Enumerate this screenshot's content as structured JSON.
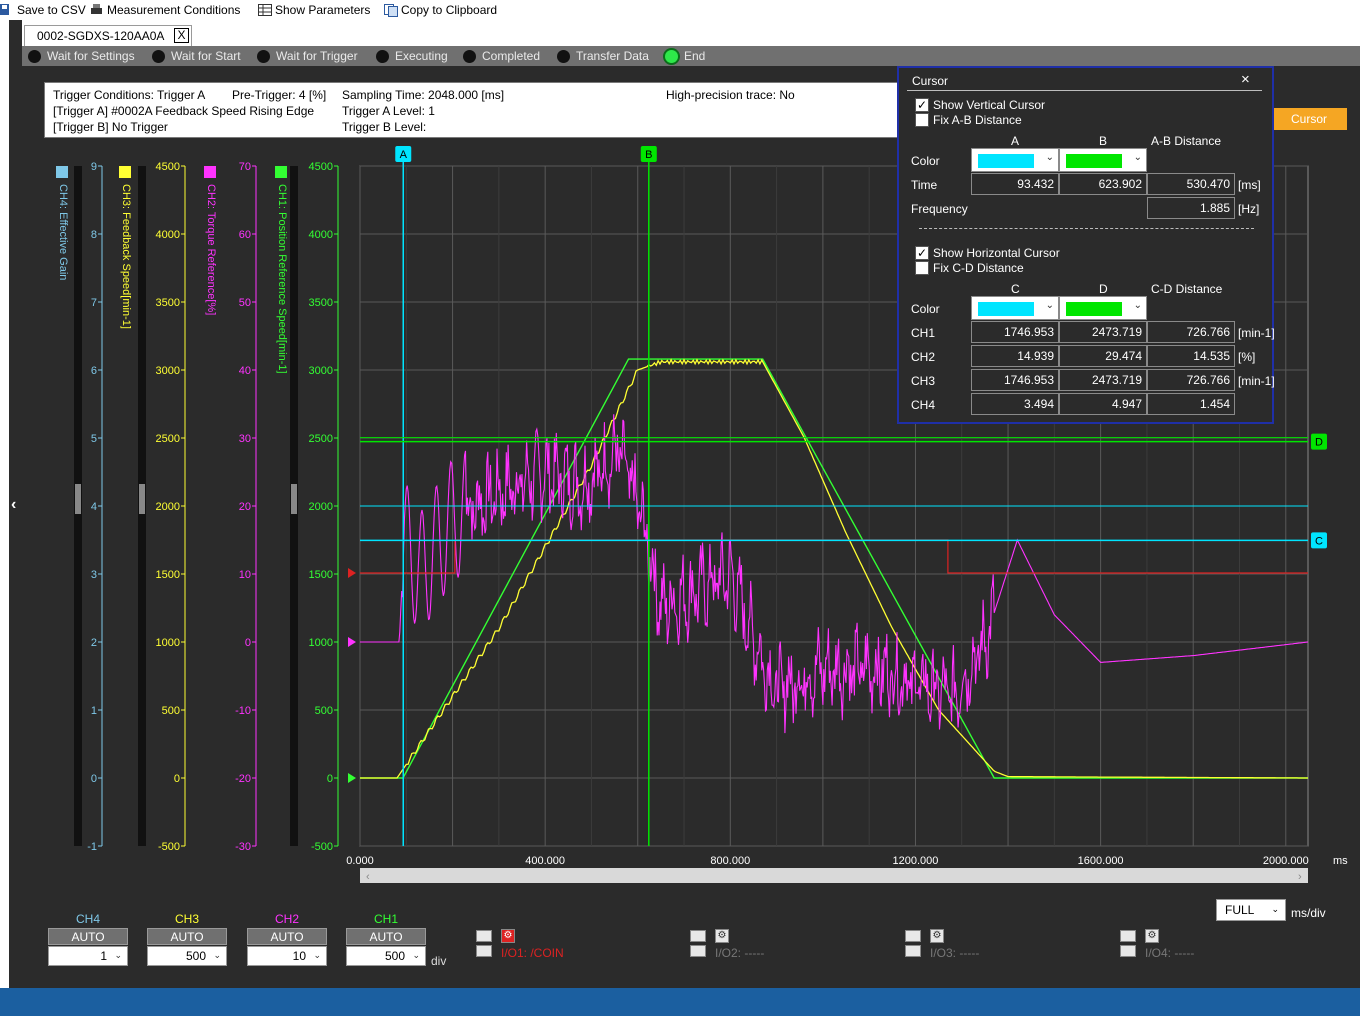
{
  "toolbar": {
    "save_csv": "Save to CSV",
    "measurement_conditions": "Measurement Conditions",
    "show_parameters": "Show Parameters",
    "copy_clipboard": "Copy to Clipboard"
  },
  "tab": {
    "label": "0002-SGDXS-120AA0A",
    "close": "X"
  },
  "status": {
    "steps": [
      "Wait for Settings",
      "Wait for Start",
      "Wait for Trigger",
      "Executing",
      "Completed",
      "Transfer Data",
      "End"
    ],
    "active_index": 6
  },
  "info": {
    "trigger_conditions": "Trigger Conditions: Trigger A",
    "pre_trigger": "Pre-Trigger: 4 [%]",
    "sampling_time": "Sampling Time: 2048.000 [ms]",
    "high_precision": "High-precision trace: No",
    "trigger_a_desc": "[Trigger A] #0002A Feedback Speed Rising Edge",
    "trigger_a_level": "Trigger A Level: 1",
    "trigger_b_desc": "[Trigger B] No Trigger",
    "trigger_b_level": "Trigger B Level:"
  },
  "cursor_button": "Cursor",
  "cursor_panel": {
    "title": "Cursor",
    "close": "×",
    "show_vertical": "Show Vertical Cursor",
    "show_vertical_checked": true,
    "fix_ab": "Fix A-B Distance",
    "fix_ab_checked": false,
    "col_a": "A",
    "col_b": "B",
    "col_ab": "A-B Distance",
    "row_color": "Color",
    "row_time": "Time",
    "row_freq": "Frequency",
    "time_a": "93.432",
    "time_b": "623.902",
    "time_ab": "530.470",
    "time_unit": "[ms]",
    "freq_ab": "1.885",
    "freq_unit": "[Hz]",
    "color_a": "#00e5ff",
    "color_b": "#00e600",
    "show_horizontal": "Show Horizontal Cursor",
    "show_horizontal_checked": true,
    "fix_cd": "Fix C-D Distance",
    "fix_cd_checked": false,
    "col_c": "C",
    "col_d": "D",
    "col_cd": "C-D Distance",
    "color_c": "#00e5ff",
    "color_d": "#00e600",
    "rows": [
      {
        "label": "CH1",
        "c": "1746.953",
        "d": "2473.719",
        "cd": "726.766",
        "unit": "[min-1]"
      },
      {
        "label": "CH2",
        "c": "14.939",
        "d": "29.474",
        "cd": "14.535",
        "unit": "[%]"
      },
      {
        "label": "CH3",
        "c": "1746.953",
        "d": "2473.719",
        "cd": "726.766",
        "unit": "[min-1]"
      },
      {
        "label": "CH4",
        "c": "3.494",
        "d": "4.947",
        "cd": "1.454",
        "unit": ""
      }
    ]
  },
  "axes": {
    "ch4": {
      "title": "CH4: Effective Gain",
      "color": "#7fc8e8",
      "ticks": [
        "9",
        "8",
        "7",
        "6",
        "5",
        "4",
        "3",
        "2",
        "1",
        "0",
        "-1"
      ]
    },
    "ch3": {
      "title": "CH3: Feedback Speed[min-1]",
      "color": "#ffff33",
      "ticks": [
        "4500",
        "4000",
        "3500",
        "3000",
        "2500",
        "2000",
        "1500",
        "1000",
        "500",
        "0",
        "-500"
      ]
    },
    "ch2": {
      "title": "CH2: Torque Reference[%]",
      "color": "#ff33ff",
      "ticks": [
        "70",
        "60",
        "50",
        "40",
        "30",
        "20",
        "10",
        "0",
        "-10",
        "-20",
        "-30"
      ]
    },
    "ch1": {
      "title": "CH1: Position Reference Speed[min-1]",
      "color": "#33ff33",
      "ticks": [
        "4500",
        "4000",
        "3500",
        "3000",
        "2500",
        "2000",
        "1500",
        "1000",
        "500",
        "0",
        "-500"
      ]
    }
  },
  "x_axis": {
    "ticks": [
      "0.000",
      "400.000",
      "800.000",
      "1200.000",
      "1600.000",
      "2000.000"
    ],
    "unit": "ms"
  },
  "chart_data": {
    "type": "line",
    "x_range_ms": [
      0,
      2048
    ],
    "cursors": {
      "A_ms": 93.432,
      "B_ms": 623.902,
      "C_ch1": 1746.953,
      "D_ch1": 2473.719
    },
    "labels": {
      "A": "A",
      "B": "B",
      "C": "C",
      "D": "D"
    },
    "series": [
      {
        "name": "CH1: Position Reference Speed[min-1]",
        "color": "#33ff33",
        "points_ms": [
          [
            0,
            0
          ],
          [
            93,
            0
          ],
          [
            580,
            3080
          ],
          [
            870,
            3080
          ],
          [
            1370,
            0
          ],
          [
            2048,
            0
          ]
        ]
      },
      {
        "name": "CH3: Feedback Speed[min-1]",
        "color": "#ffff33",
        "points_ms": [
          [
            0,
            0
          ],
          [
            80,
            0
          ],
          [
            120,
            200
          ],
          [
            300,
            1100
          ],
          [
            500,
            2300
          ],
          [
            600,
            3000
          ],
          [
            650,
            3060
          ],
          [
            870,
            3060
          ],
          [
            960,
            2500
          ],
          [
            1050,
            1800
          ],
          [
            1150,
            1100
          ],
          [
            1250,
            500
          ],
          [
            1370,
            50
          ],
          [
            1400,
            10
          ],
          [
            2048,
            0
          ]
        ]
      },
      {
        "name": "CH2: Torque Reference[%]",
        "color": "#ff33ff",
        "summary_points_ms": [
          [
            0,
            0
          ],
          [
            85,
            0
          ],
          [
            95,
            15
          ],
          [
            130,
            10
          ],
          [
            200,
            18
          ],
          [
            300,
            22
          ],
          [
            400,
            25
          ],
          [
            480,
            23
          ],
          [
            560,
            28
          ],
          [
            610,
            18
          ],
          [
            650,
            5
          ],
          [
            800,
            10
          ],
          [
            870,
            -3
          ],
          [
            900,
            -7
          ],
          [
            1000,
            -4
          ],
          [
            1120,
            -4
          ],
          [
            1280,
            -8
          ],
          [
            1350,
            0
          ],
          [
            1420,
            15
          ],
          [
            1500,
            4
          ],
          [
            1600,
            -3
          ],
          [
            1800,
            -2
          ],
          [
            2048,
            0
          ]
        ]
      },
      {
        "name": "I/O1: /COIN",
        "color": "#dd2222",
        "points_ms": [
          [
            0,
            0
          ],
          [
            205,
            0
          ],
          [
            205,
            1
          ],
          [
            1270,
            1
          ],
          [
            1270,
            0
          ],
          [
            2048,
            0
          ]
        ]
      }
    ]
  },
  "controls": {
    "channels": [
      {
        "name": "CH4",
        "auto": "AUTO",
        "value": "1",
        "color": "#7fc8e8"
      },
      {
        "name": "CH3",
        "auto": "AUTO",
        "value": "500",
        "color": "#ffff33"
      },
      {
        "name": "CH2",
        "auto": "AUTO",
        "value": "10",
        "color": "#ff33ff"
      },
      {
        "name": "CH1",
        "auto": "AUTO",
        "value": "500",
        "color": "#33ff33"
      }
    ],
    "div": "div",
    "io": [
      "I/O1: /COIN",
      "I/O2: -----",
      "I/O3: -----",
      "I/O4: -----"
    ],
    "io1_color": "#dd2222",
    "full": "FULL",
    "ms_div": "ms/div"
  }
}
